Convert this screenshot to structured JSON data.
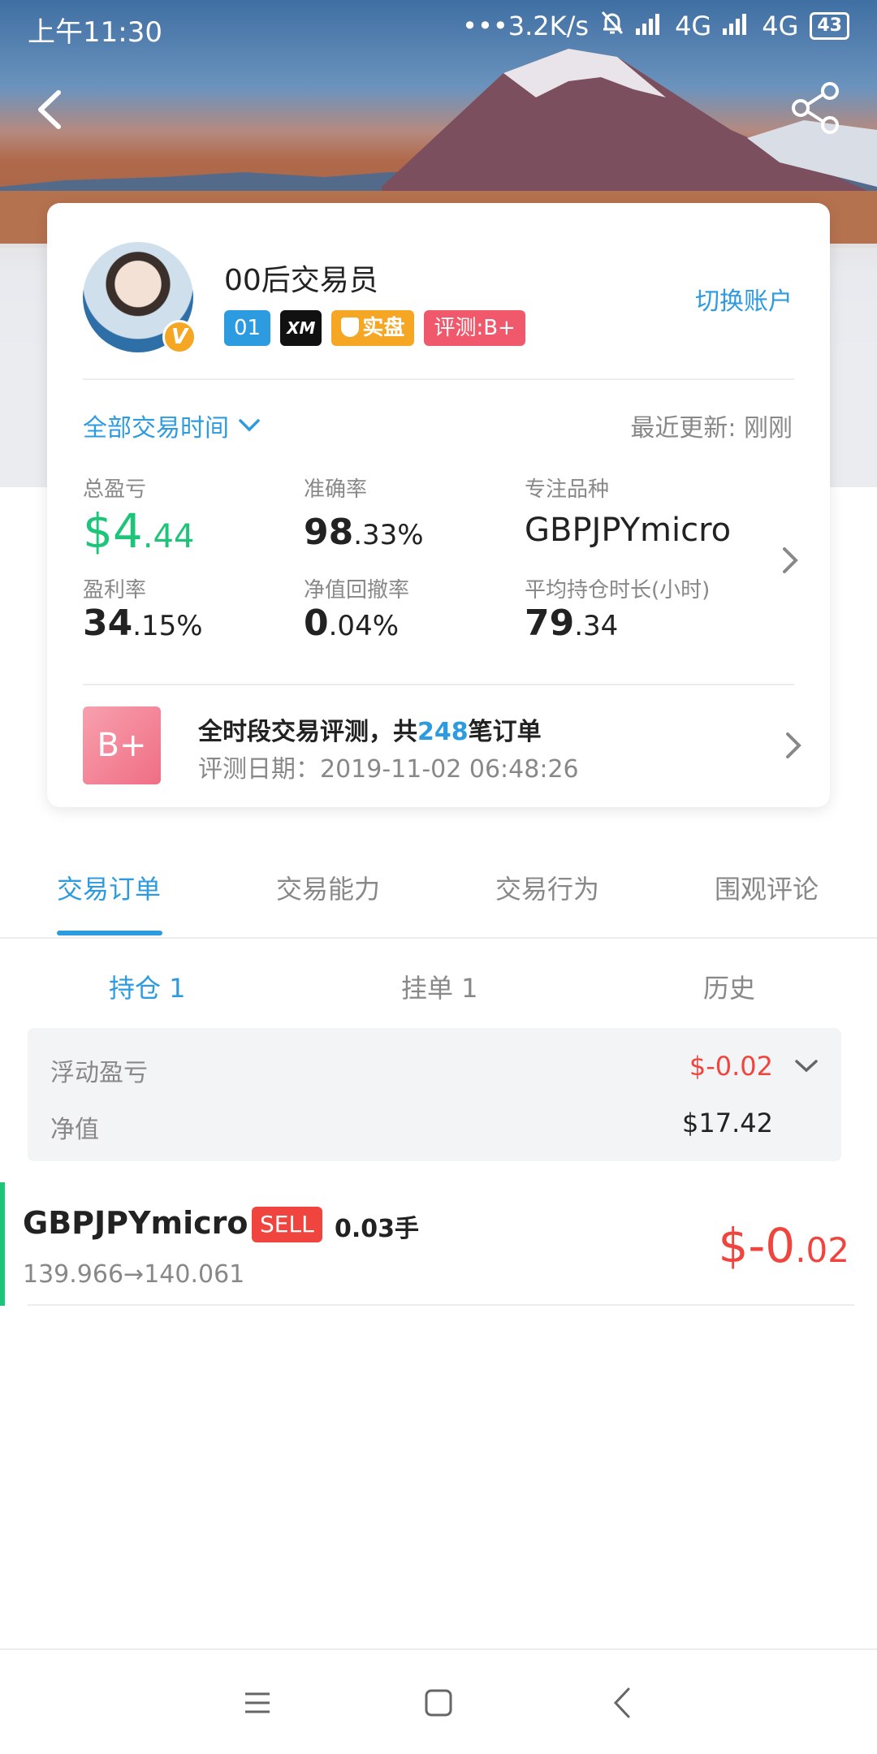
{
  "status_bar": {
    "time": "上午11:30",
    "net_speed": "•••3.2K/s",
    "network1": "4G",
    "network2": "4G",
    "battery": "43"
  },
  "nav": {
    "back_icon": "chevron-left-icon",
    "share_icon": "share-icon"
  },
  "profile": {
    "name": "00后交易员",
    "verified_icon": "v-badge-icon",
    "badges": {
      "level": "01",
      "broker": "XM",
      "account_type": "实盘",
      "rating": "评测:B+"
    },
    "switch_account": "切换账户"
  },
  "filters": {
    "time_range": "全部交易时间",
    "last_update": "最近更新: 刚刚"
  },
  "stats": {
    "total_pl": {
      "label": "总盈亏",
      "int": "$4",
      "dec": ".44"
    },
    "accuracy": {
      "label": "准确率",
      "int": "98",
      "dec": ".33%"
    },
    "focus_symbol": {
      "label": "专注品种",
      "value": "GBPJPYmicro"
    },
    "profit_rate": {
      "label": "盈利率",
      "int": "34",
      "dec": ".15%"
    },
    "drawdown": {
      "label": "净值回撤率",
      "int": "0",
      "dec": ".04%"
    },
    "avg_hold": {
      "label": "平均持仓时长(小时)",
      "int": "79",
      "dec": ".34"
    }
  },
  "evaluation": {
    "grade": "B+",
    "title_prefix": "全时段交易评测，共",
    "order_count": "248",
    "title_suffix": "笔订单",
    "date": "评测日期：2019-11-02 06:48:26"
  },
  "tabs": [
    "交易订单",
    "交易能力",
    "交易行为",
    "围观评论"
  ],
  "subtabs": [
    "持仓 1",
    "挂单 1",
    "历史"
  ],
  "summary": {
    "floating_label": "浮动盈亏",
    "floating_value": "$-0.02",
    "equity_label": "净值",
    "equity_value": "$17.42"
  },
  "positions": [
    {
      "symbol": "GBPJPYmicro",
      "side": "SELL",
      "lots": "0.03手",
      "prices": "139.966→140.061",
      "pl_int": "$-0",
      "pl_dec": ".02"
    }
  ],
  "colors": {
    "accent": "#2d9be0",
    "positive": "#1ec47a",
    "negative": "#f0453f",
    "gold": "#f5a623",
    "rating_pink": "#f0596c"
  }
}
